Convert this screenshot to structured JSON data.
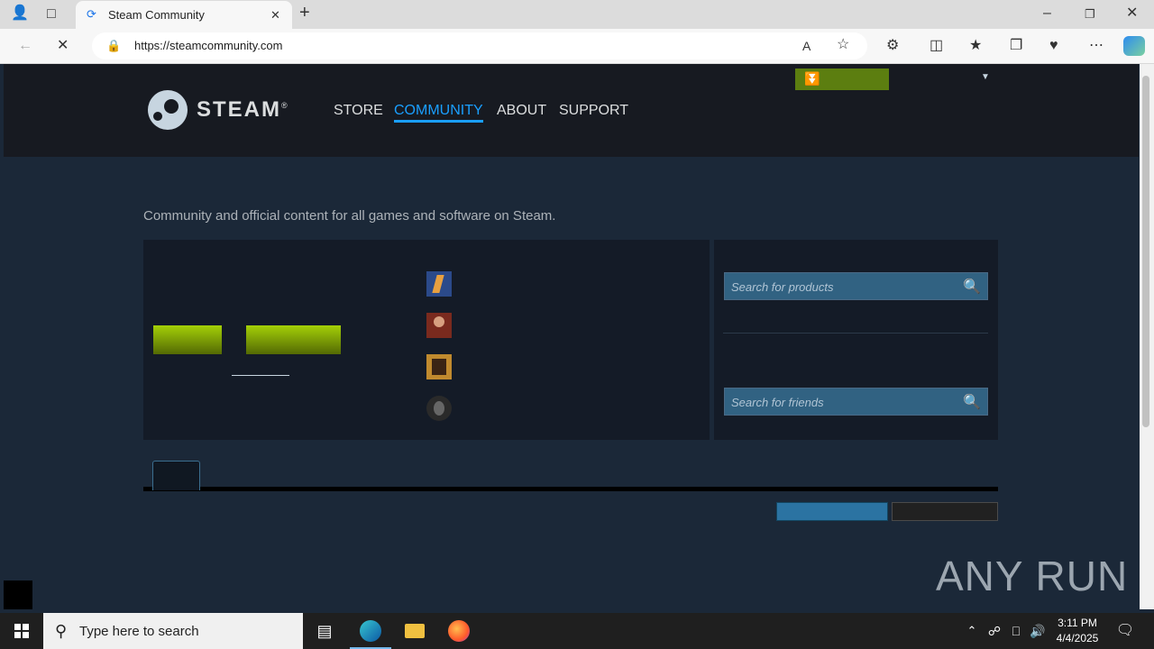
{
  "browser": {
    "tab_title": "Steam Community",
    "url": "https://steamcommunity.com",
    "new_tab_symbol": "+",
    "window_controls": [
      "–",
      "❐",
      "✕"
    ]
  },
  "steam_header": {
    "logo_text": "STEAM",
    "logo_mark": "®",
    "nav": [
      {
        "label": "STORE"
      },
      {
        "label": "COMMUNITY"
      },
      {
        "label": "ABOUT"
      },
      {
        "label": "SUPPORT"
      }
    ]
  },
  "main": {
    "tagline": "Community and official content for all games and software on Steam.",
    "search_products_placeholder": "Search for products",
    "search_friends_placeholder": "Search for friends"
  },
  "watermark": "ANY RUN",
  "taskbar": {
    "search_placeholder": "Type here to search",
    "time": "3:11 PM",
    "date": "4/4/2025"
  },
  "colors": {
    "header_bg": "#171a21",
    "page_bg": "#1b2838",
    "accent": "#1a9fff",
    "install_green": "#5c7e10"
  }
}
